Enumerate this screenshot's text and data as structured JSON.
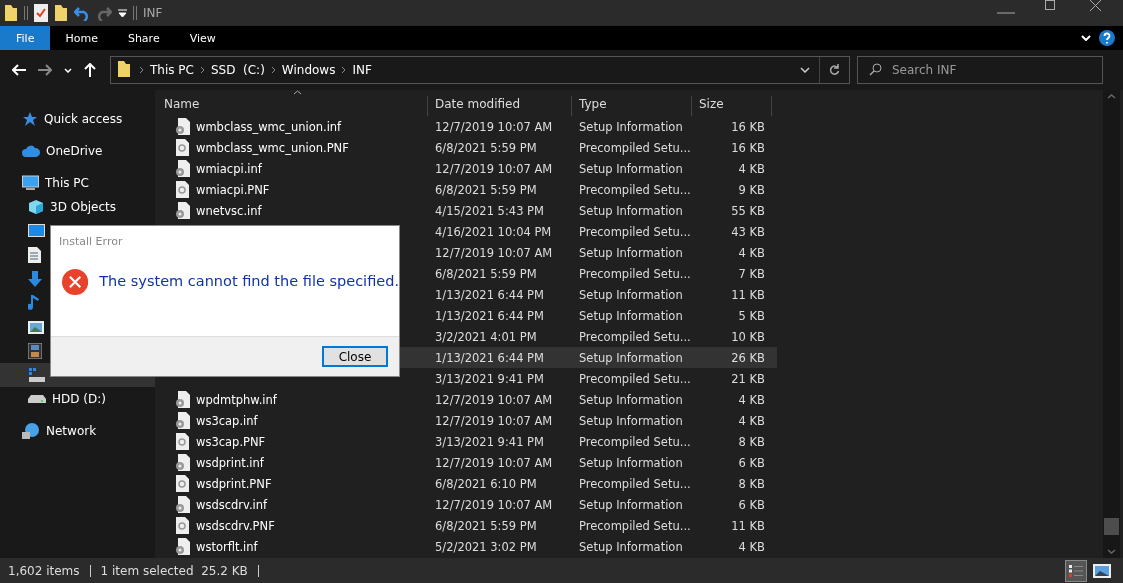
{
  "window": {
    "title": "INF"
  },
  "ribbon": {
    "tabs": [
      {
        "label": "File",
        "selected": true
      },
      {
        "label": "Home",
        "selected": false
      },
      {
        "label": "Share",
        "selected": false
      },
      {
        "label": "View",
        "selected": false
      }
    ]
  },
  "address": {
    "crumbs": [
      "This PC",
      "SSD  (C:)",
      "Windows",
      "INF"
    ]
  },
  "search": {
    "placeholder": "Search INF"
  },
  "sidebar": {
    "items": [
      {
        "label": "Quick access",
        "kind": "star",
        "selected": false
      },
      {
        "label": "OneDrive",
        "kind": "cloud",
        "selected": false
      },
      {
        "label": "This PC",
        "kind": "pc",
        "selected": false,
        "children": [
          {
            "label": "3D Objects",
            "kind": "cube",
            "selected": false
          },
          {
            "kind": "desktop",
            "selected": false
          },
          {
            "kind": "document",
            "selected": false
          },
          {
            "kind": "download",
            "selected": false
          },
          {
            "kind": "music",
            "selected": false
          },
          {
            "kind": "pictures",
            "selected": false
          },
          {
            "kind": "video",
            "selected": false
          },
          {
            "kind": "ssd",
            "selected": true
          },
          {
            "label": "HDD (D:)",
            "kind": "drive",
            "selected": false
          }
        ]
      },
      {
        "label": "Network",
        "kind": "network",
        "selected": false
      }
    ]
  },
  "table": {
    "columns": [
      "Name",
      "Date modified",
      "Type",
      "Size"
    ],
    "rows": [
      {
        "name": "wmbclass_wmc_union.inf",
        "kind": "inf",
        "date": "12/7/2019 10:07 AM",
        "type": "Setup Information",
        "size": "16 KB",
        "selected": false
      },
      {
        "name": "wmbclass_wmc_union.PNF",
        "kind": "pnf",
        "date": "6/8/2021 5:59 PM",
        "type": "Precompiled Setu...",
        "size": "16 KB",
        "selected": false
      },
      {
        "name": "wmiacpi.inf",
        "kind": "inf",
        "date": "12/7/2019 10:07 AM",
        "type": "Setup Information",
        "size": "4 KB",
        "selected": false
      },
      {
        "name": "wmiacpi.PNF",
        "kind": "pnf",
        "date": "6/8/2021 5:59 PM",
        "type": "Precompiled Setu...",
        "size": "9 KB",
        "selected": false
      },
      {
        "name": "wnetvsc.inf",
        "kind": "inf",
        "date": "4/15/2021 5:43 PM",
        "type": "Setup Information",
        "size": "55 KB",
        "selected": false
      },
      {
        "date": "4/16/2021 10:04 PM",
        "type": "Precompiled Setu...",
        "size": "43 KB",
        "selected": false
      },
      {
        "date": "12/7/2019 10:07 AM",
        "type": "Setup Information",
        "size": "4 KB",
        "selected": false
      },
      {
        "date": "6/8/2021 5:59 PM",
        "type": "Precompiled Setu...",
        "size": "7 KB",
        "selected": false
      },
      {
        "date": "1/13/2021 6:44 PM",
        "type": "Setup Information",
        "size": "11 KB",
        "selected": false
      },
      {
        "date": "1/13/2021 6:44 PM",
        "type": "Setup Information",
        "size": "5 KB",
        "selected": false
      },
      {
        "date": "3/2/2021 4:01 PM",
        "type": "Precompiled Setu...",
        "size": "10 KB",
        "selected": false
      },
      {
        "date": "1/13/2021 6:44 PM",
        "type": "Setup Information",
        "size": "26 KB",
        "selected": true
      },
      {
        "date": "3/13/2021 9:41 PM",
        "type": "Precompiled Setu...",
        "size": "21 KB",
        "selected": false
      },
      {
        "name": "wpdmtphw.inf",
        "kind": "inf",
        "date": "12/7/2019 10:07 AM",
        "type": "Setup Information",
        "size": "4 KB",
        "selected": false
      },
      {
        "name": "ws3cap.inf",
        "kind": "inf",
        "date": "12/7/2019 10:07 AM",
        "type": "Setup Information",
        "size": "4 KB",
        "selected": false
      },
      {
        "name": "ws3cap.PNF",
        "kind": "pnf",
        "date": "3/13/2021 9:41 PM",
        "type": "Precompiled Setu...",
        "size": "8 KB",
        "selected": false
      },
      {
        "name": "wsdprint.inf",
        "kind": "inf",
        "date": "12/7/2019 10:07 AM",
        "type": "Setup Information",
        "size": "6 KB",
        "selected": false
      },
      {
        "name": "wsdprint.PNF",
        "kind": "pnf",
        "date": "6/8/2021 6:10 PM",
        "type": "Precompiled Setu...",
        "size": "8 KB",
        "selected": false
      },
      {
        "name": "wsdscdrv.inf",
        "kind": "inf",
        "date": "12/7/2019 10:07 AM",
        "type": "Setup Information",
        "size": "6 KB",
        "selected": false
      },
      {
        "name": "wsdscdrv.PNF",
        "kind": "pnf",
        "date": "6/8/2021 5:59 PM",
        "type": "Precompiled Setu...",
        "size": "11 KB",
        "selected": false
      },
      {
        "name": "wstorflt.inf",
        "kind": "inf",
        "date": "5/2/2021 3:02 PM",
        "type": "Setup Information",
        "size": "4 KB",
        "selected": false
      }
    ]
  },
  "status_bar": {
    "item_count": "1,602 items",
    "selection": "1 item selected  25.2 KB"
  },
  "dialog": {
    "title": "Install Error",
    "message": "The system cannot find the file specified.",
    "button": "Close"
  }
}
